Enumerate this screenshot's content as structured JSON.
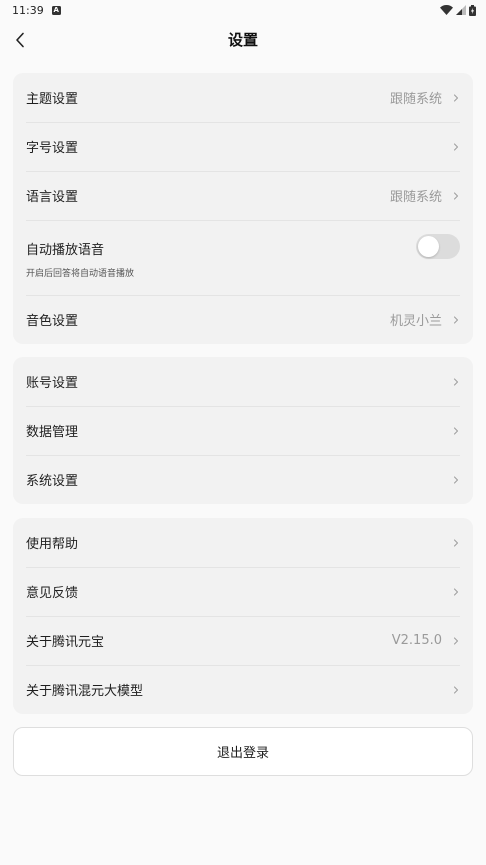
{
  "status_bar": {
    "time": "11:39",
    "badge": "A"
  },
  "header": {
    "title": "设置"
  },
  "group1": {
    "theme": {
      "label": "主题设置",
      "value": "跟随系统"
    },
    "font_size": {
      "label": "字号设置"
    },
    "language": {
      "label": "语言设置",
      "value": "跟随系统"
    },
    "autoplay": {
      "label": "自动播放语音",
      "subtitle": "开启后回答将自动语音播放",
      "enabled": false
    },
    "voice": {
      "label": "音色设置",
      "value": "机灵小兰"
    }
  },
  "group2": {
    "account": {
      "label": "账号设置"
    },
    "data": {
      "label": "数据管理"
    },
    "system": {
      "label": "系统设置"
    }
  },
  "group3": {
    "help": {
      "label": "使用帮助"
    },
    "feedback": {
      "label": "意见反馈"
    },
    "about_app": {
      "label": "关于腾讯元宝",
      "value": "V2.15.0"
    },
    "about_model": {
      "label": "关于腾讯混元大模型"
    }
  },
  "logout": {
    "label": "退出登录"
  },
  "icons": {
    "back": "chevron-left-icon",
    "chevron": "chevron-right-icon",
    "wifi": "wifi-icon",
    "signal": "signal-icon",
    "battery": "battery-icon"
  },
  "colors": {
    "background": "#fafafa",
    "card": "#f2f2f2",
    "secondary_text": "#9a9a9a",
    "toggle_off": "#dcdcdc"
  }
}
